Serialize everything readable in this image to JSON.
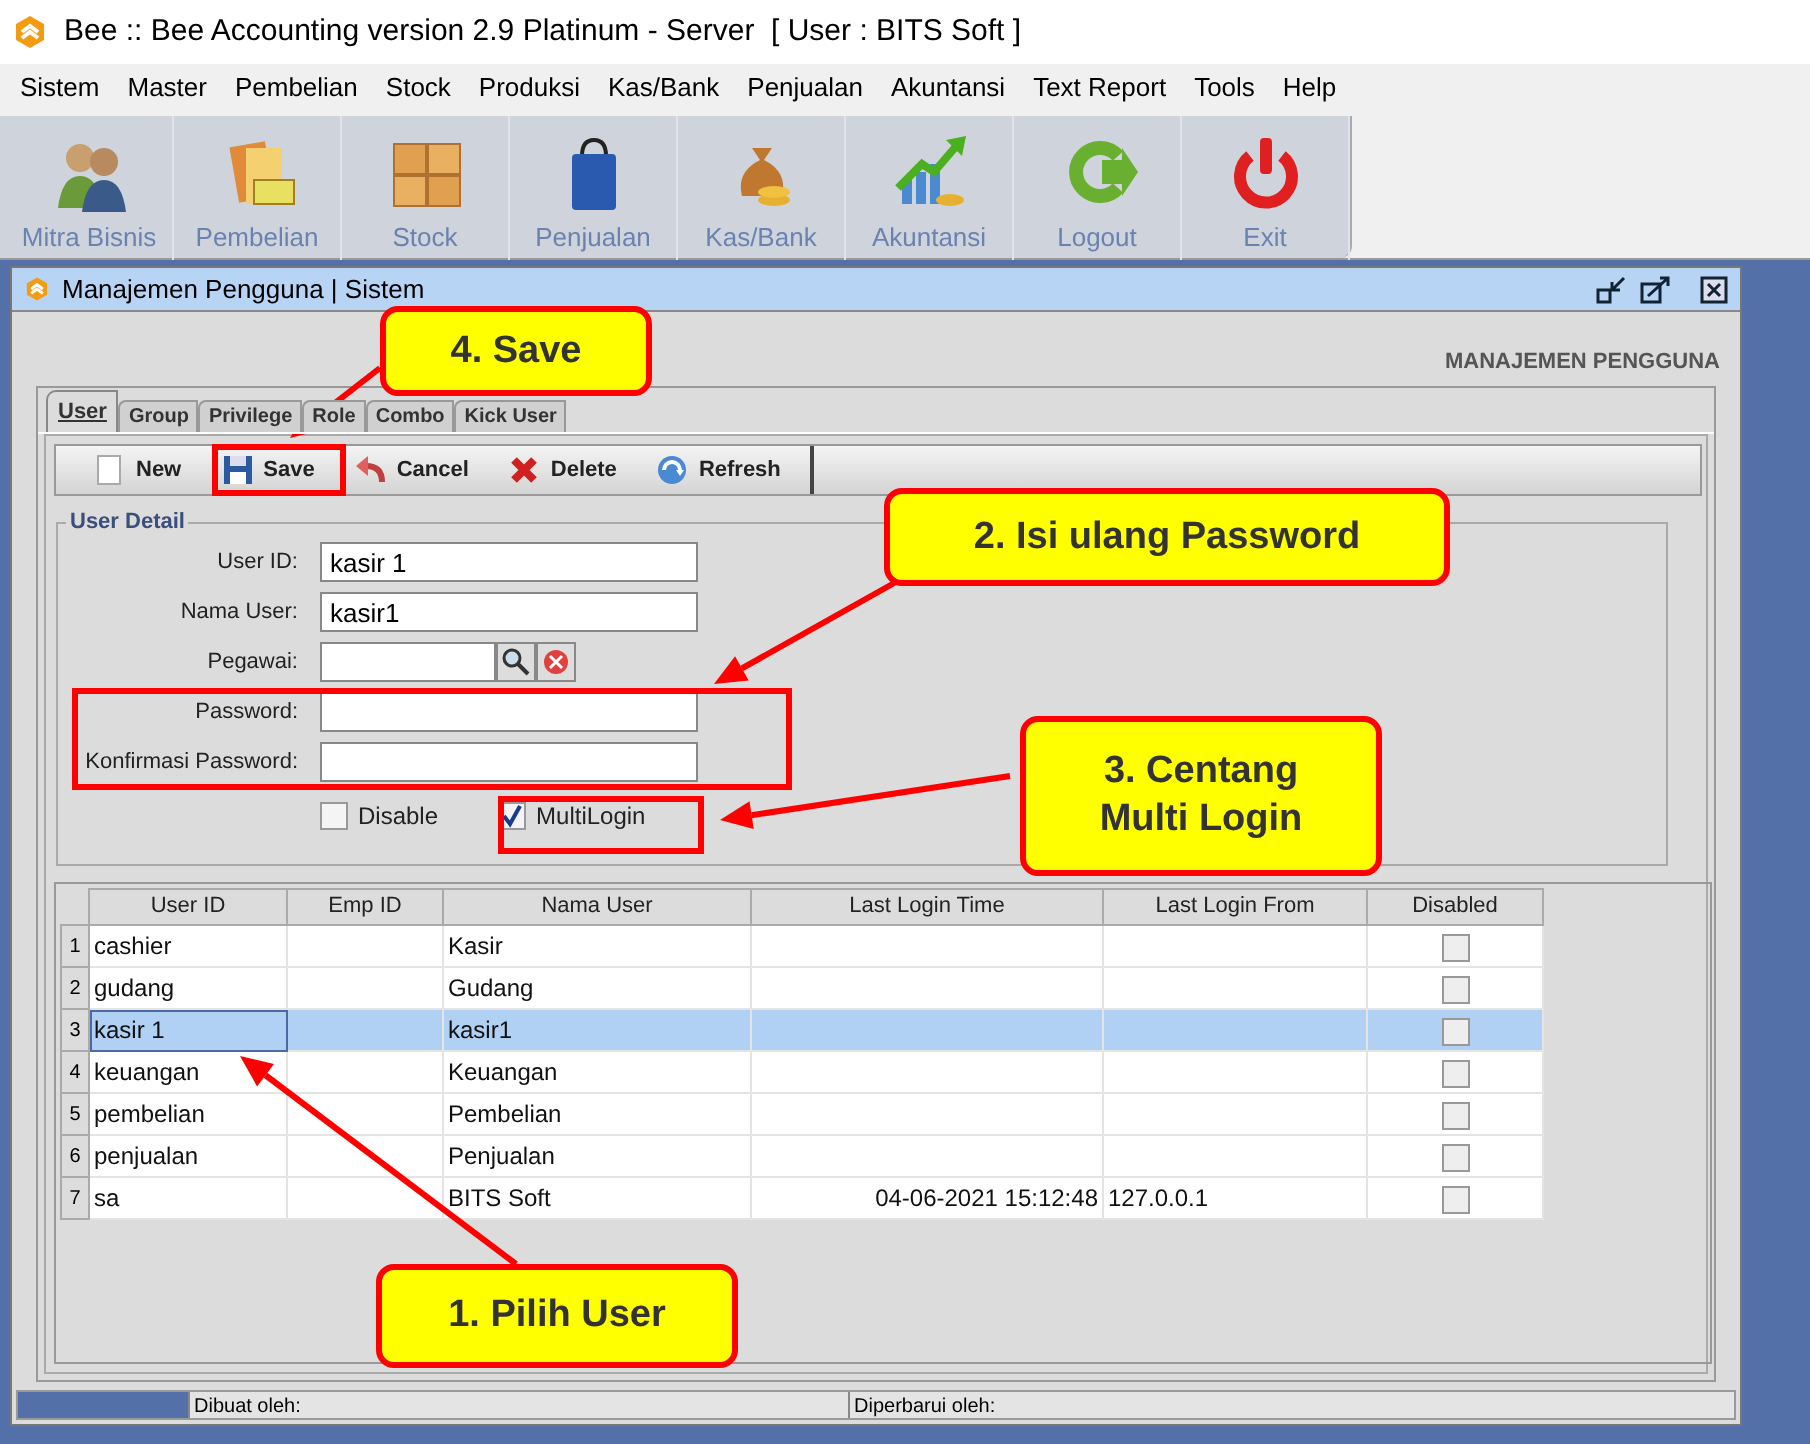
{
  "window": {
    "title": "Bee :: Bee Accounting version 2.9 Platinum - Server  [ User : BITS Soft ]"
  },
  "menu": [
    "Sistem",
    "Master",
    "Pembelian",
    "Stock",
    "Produksi",
    "Kas/Bank",
    "Penjualan",
    "Akuntansi",
    "Text Report",
    "Tools",
    "Help"
  ],
  "toolbar": [
    {
      "label": "Mitra Bisnis",
      "kind": "people"
    },
    {
      "label": "Pembelian",
      "kind": "books"
    },
    {
      "label": "Stock",
      "kind": "boxes"
    },
    {
      "label": "Penjualan",
      "kind": "bag"
    },
    {
      "label": "Kas/Bank",
      "kind": "money"
    },
    {
      "label": "Akuntansi",
      "kind": "chart"
    },
    {
      "label": "Logout",
      "kind": "logout"
    },
    {
      "label": "Exit",
      "kind": "power"
    }
  ],
  "frame": {
    "title": "Manajemen Pengguna | Sistem",
    "header": "MANAJEMEN PENGGUNA",
    "tabs": [
      {
        "label": "User",
        "selected": true
      },
      {
        "label": "Group",
        "selected": false
      },
      {
        "label": "Privilege",
        "selected": false
      },
      {
        "label": "Role",
        "selected": false
      },
      {
        "label": "Combo",
        "selected": false
      },
      {
        "label": "Kick User",
        "selected": false
      }
    ],
    "actions": [
      {
        "label": "New",
        "kind": "new"
      },
      {
        "label": "Save",
        "kind": "save"
      },
      {
        "label": "Cancel",
        "kind": "cancel"
      },
      {
        "label": "Delete",
        "kind": "delete"
      },
      {
        "label": "Refresh",
        "kind": "refresh"
      }
    ],
    "group_title": "User Detail",
    "fields": [
      {
        "label": "User ID:",
        "value": "kasir 1",
        "kind": "text"
      },
      {
        "label": "Nama User:",
        "value": "kasir1",
        "kind": "text"
      },
      {
        "label": "Pegawai:",
        "kind": "lookup"
      },
      {
        "label": "Password:",
        "kind": "text"
      },
      {
        "label": "Konfirmasi Password:",
        "kind": "text"
      }
    ],
    "checkboxes": [
      {
        "label": "Disable",
        "checked": false
      },
      {
        "label": "MultiLogin",
        "checked": true
      }
    ],
    "table": {
      "columns": [
        "User ID",
        "Emp ID",
        "Nama User",
        "Last Login Time",
        "Last Login From",
        "Disabled"
      ],
      "rows": [
        {
          "number": "1",
          "user_id": "cashier",
          "nama_user": "Kasir",
          "disabled": false,
          "selected": false
        },
        {
          "number": "2",
          "user_id": "gudang",
          "nama_user": "Gudang",
          "disabled": false,
          "selected": false
        },
        {
          "number": "3",
          "user_id": "kasir 1",
          "nama_user": "kasir1",
          "disabled": false,
          "selected": true
        },
        {
          "number": "4",
          "user_id": "keuangan",
          "nama_user": "Keuangan",
          "disabled": false,
          "selected": false
        },
        {
          "number": "5",
          "user_id": "pembelian",
          "nama_user": "Pembelian",
          "disabled": false,
          "selected": false
        },
        {
          "number": "6",
          "user_id": "penjualan",
          "nama_user": "Penjualan",
          "disabled": false,
          "selected": false
        },
        {
          "number": "7",
          "user_id": "sa",
          "nama_user": "BITS Soft",
          "last_login_time": "04-06-2021 15:12:48",
          "last_login_from": "127.0.0.1",
          "disabled": false,
          "selected": false
        }
      ]
    },
    "status_bar": [
      "Dibuat oleh:",
      "Diperbarui oleh:"
    ]
  },
  "callouts": [
    {
      "text": "4. Save"
    },
    {
      "text": "2. Isi ulang Password"
    },
    {
      "text": "3. Centang Multi Login"
    },
    {
      "text": "1. Pilih User"
    }
  ]
}
